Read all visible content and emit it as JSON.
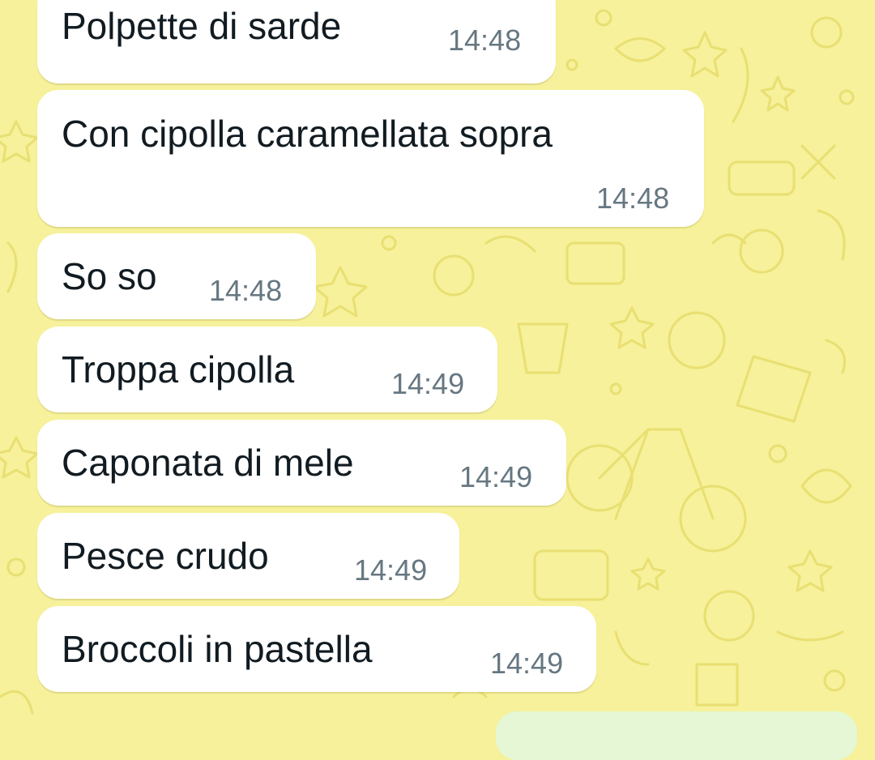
{
  "theme": {
    "wallpaper_color": "#f6f19a",
    "doodle_color": "#e9df72",
    "incoming_bubble_color": "#ffffff",
    "outgoing_bubble_color": "#e5f7d4",
    "text_color": "#111b21",
    "time_color": "#667781"
  },
  "messages": [
    {
      "text": "Polpette di sarde",
      "time": "14:48"
    },
    {
      "text": "Con cipolla caramellata sopra",
      "time": "14:48"
    },
    {
      "text": "So so",
      "time": "14:48"
    },
    {
      "text": "Troppa cipolla",
      "time": "14:49"
    },
    {
      "text": "Caponata di mele",
      "time": "14:49"
    },
    {
      "text": "Pesce crudo",
      "time": "14:49"
    },
    {
      "text": "Broccoli in pastella",
      "time": "14:49"
    }
  ]
}
